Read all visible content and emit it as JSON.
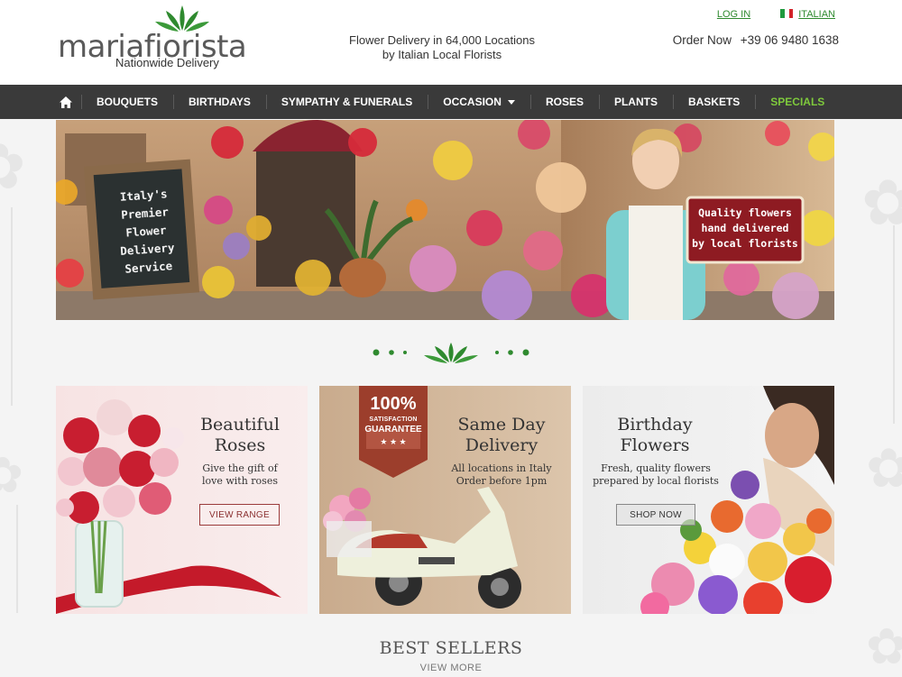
{
  "header": {
    "logo_text": "mariafiorista",
    "logo_sub": "Nationwide Delivery",
    "tagline_line1": "Flower Delivery in 64,000 Locations",
    "tagline_line2": "by Italian Local Florists",
    "login": "LOG IN",
    "language": "ITALIAN",
    "order_label": "Order Now",
    "phone": "+39 06 9480 1638"
  },
  "nav": {
    "items": [
      "BOUQUETS",
      "BIRTHDAYS",
      "SYMPATHY & FUNERALS",
      "OCCASION",
      "ROSES",
      "PLANTS",
      "BASKETS",
      "SPECIALS"
    ]
  },
  "hero": {
    "chalkboard": [
      "Italy's",
      "Premier",
      "Flower",
      "Delivery",
      "Service"
    ],
    "sign": [
      "Quality flowers",
      "hand delivered",
      "by local florists"
    ]
  },
  "cards": [
    {
      "title1": "Beautiful",
      "title2": "Roses",
      "text1": "Give the gift of",
      "text2": "love with roses",
      "button": "VIEW RANGE"
    },
    {
      "badge1": "100%",
      "badge2": "SATISFACTION",
      "badge3": "GUARANTEE",
      "title1": "Same Day",
      "title2": "Delivery",
      "text1": "All locations in Italy",
      "text2": "Order before 1pm"
    },
    {
      "title1": "Birthday",
      "title2": "Flowers",
      "text1": "Fresh, quality flowers",
      "text2": "prepared by local florists",
      "button": "SHOP NOW"
    }
  ],
  "best_sellers": {
    "title": "BEST SELLERS",
    "link": "VIEW MORE"
  },
  "colors": {
    "brand_green": "#2f8a2f",
    "nav_bg": "#3a3a3a",
    "special": "#7ec93c",
    "accent_red": "#9b3b3b"
  },
  "icons": [
    "home-icon",
    "caret-down-icon",
    "italy-flag-icon",
    "leaf-logo-icon"
  ]
}
